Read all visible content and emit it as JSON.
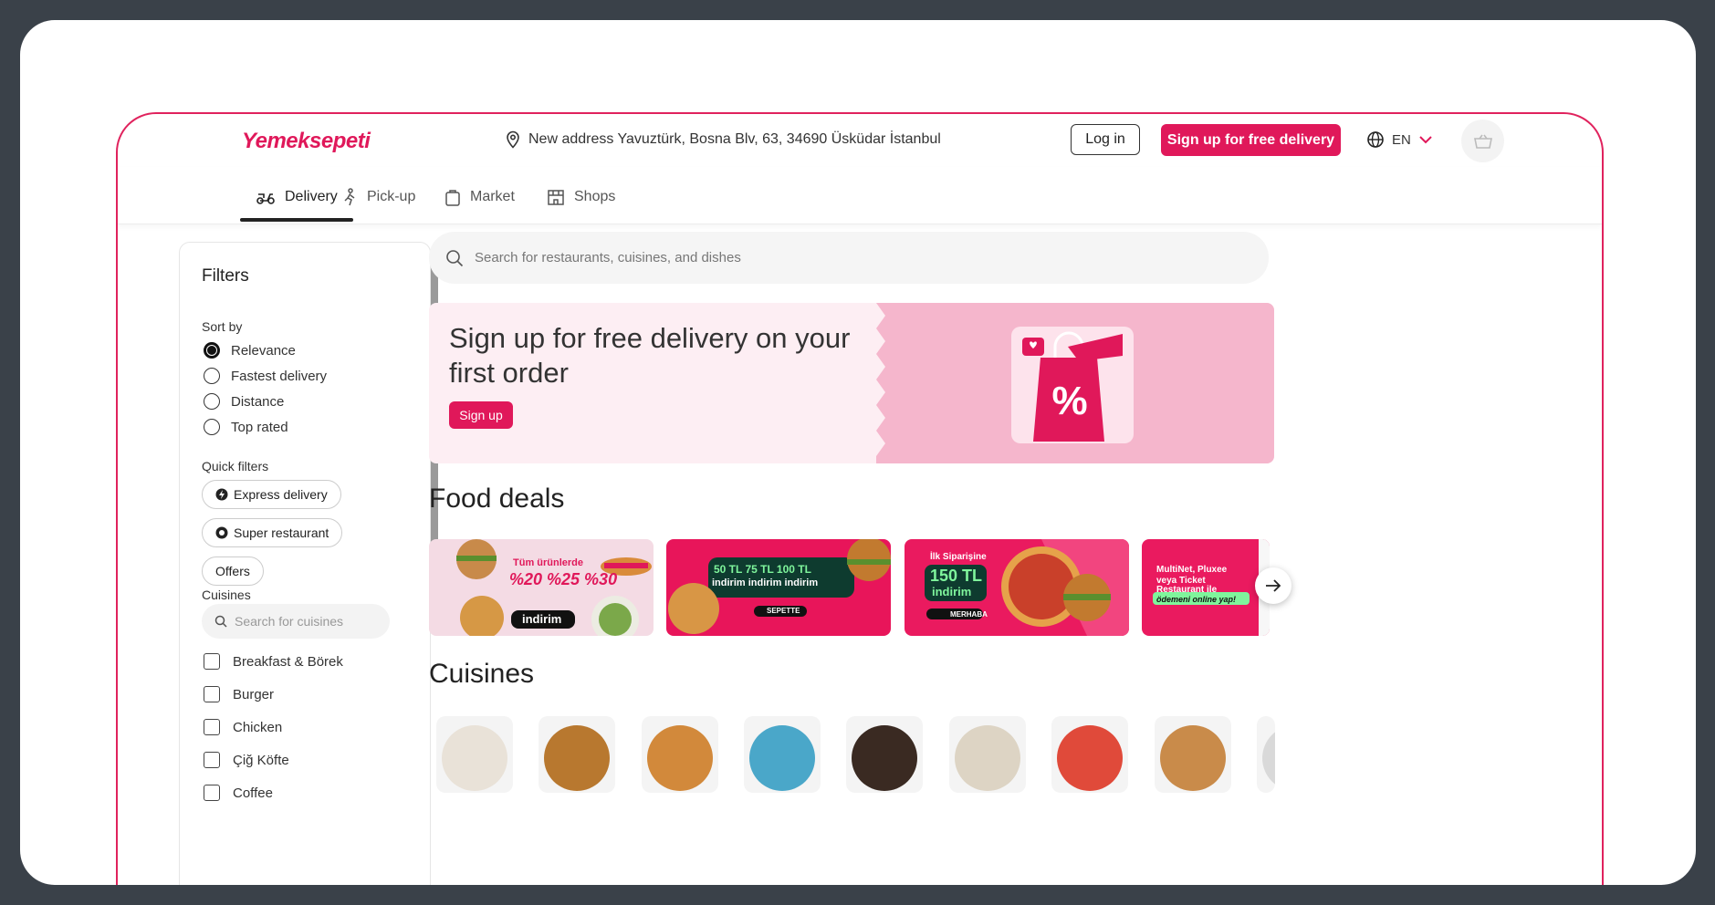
{
  "header": {
    "logo": "Yemeksepeti",
    "address": "New address Yavuztürk, Bosna Blv, 63, 34690 Üsküdar İstanbul",
    "login_label": "Log in",
    "signup_label": "Sign up for free delivery",
    "language": "EN"
  },
  "tabs": [
    {
      "label": "Delivery",
      "icon": "scooter-icon",
      "active": true
    },
    {
      "label": "Pick-up",
      "icon": "walking-icon",
      "active": false
    },
    {
      "label": "Market",
      "icon": "bag-icon",
      "active": false
    },
    {
      "label": "Shops",
      "icon": "store-icon",
      "active": false
    }
  ],
  "filters": {
    "title": "Filters",
    "sort_label": "Sort by",
    "sort_options": [
      "Relevance",
      "Fastest delivery",
      "Distance",
      "Top rated"
    ],
    "sort_selected": "Relevance",
    "quick_label": "Quick filters",
    "quick_filters": [
      "Express delivery",
      "Super restaurant",
      "Offers"
    ],
    "cuisines_label": "Cuisines",
    "cuisine_search_placeholder": "Search for cuisines",
    "cuisines": [
      "Breakfast & Börek",
      "Burger",
      "Chicken",
      "Çiğ Köfte",
      "Coffee"
    ]
  },
  "main": {
    "search_placeholder": "Search for restaurants, cuisines, and dishes",
    "banner_title": "Sign up for free delivery on your first order",
    "banner_button": "Sign up",
    "food_deals_title": "Food deals",
    "cuisines_title": "Cuisines",
    "deals": [
      {
        "line1": "Tüm ürünlerde",
        "line2": "%20 %25 %30",
        "line3": "indirim"
      },
      {
        "line1": "50 TL  75 TL  100 TL",
        "line2": "indirim  indirim  indirim",
        "line3": "SEPETTE"
      },
      {
        "line1": "İlk Siparişine",
        "line2": "150 TL",
        "line3": "indirim",
        "line4": "MERHABA"
      },
      {
        "line1": "MultiNet, Pluxee",
        "line2": "veya Ticket",
        "line3": "Restaurant ile",
        "line4": "ödemeni online yap!"
      }
    ]
  },
  "colors": {
    "brand": "#e0185a",
    "banner_bg": "#fdeef3",
    "banner_art": "#f5b6cc",
    "frame": "#3a4149"
  }
}
